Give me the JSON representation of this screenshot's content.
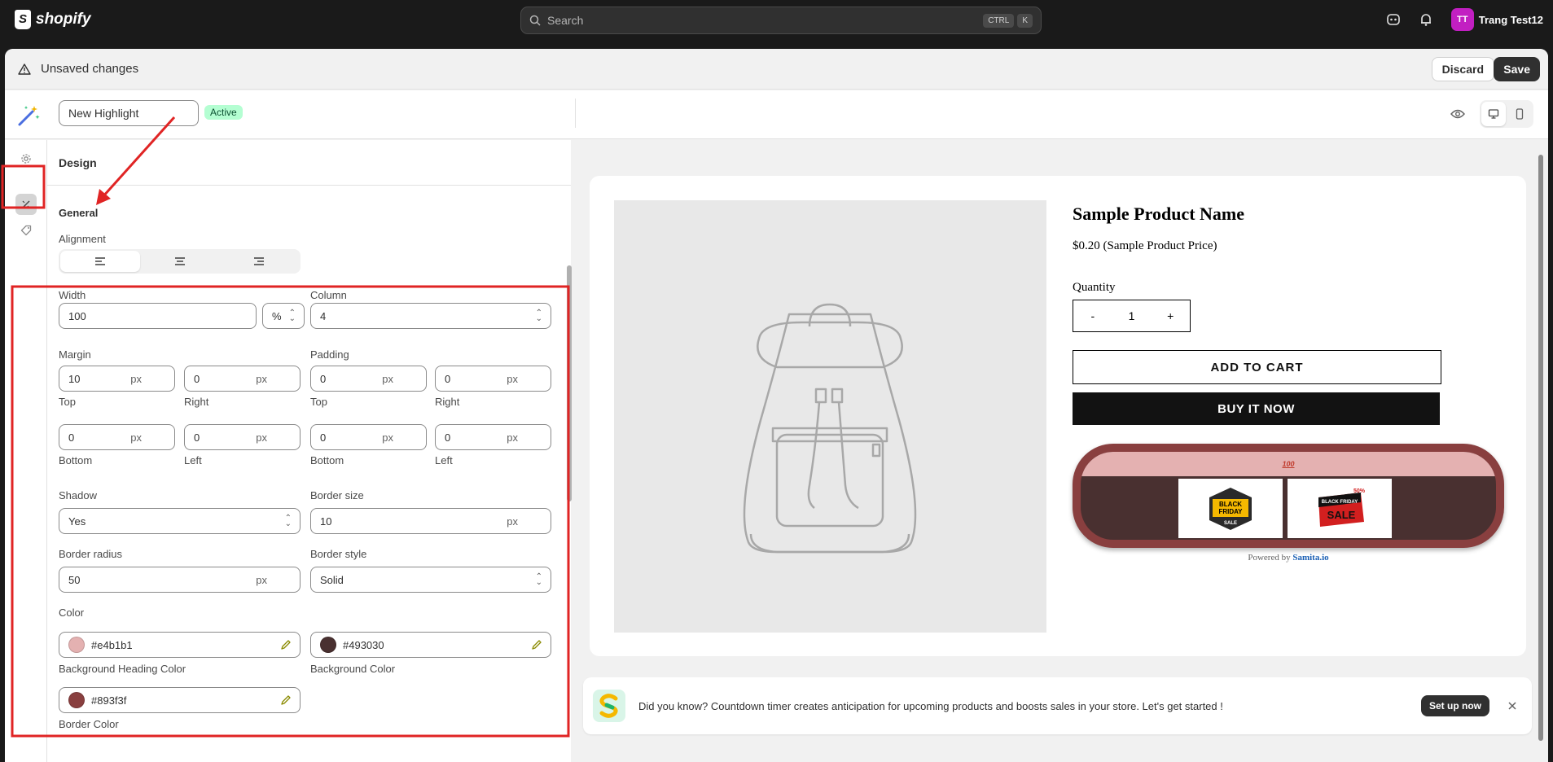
{
  "topbar": {
    "logo_text": "shopify",
    "search_placeholder": "Search",
    "shortcut_key1": "CTRL",
    "shortcut_key2": "K",
    "user_initials": "TT",
    "user_name": "Trang Test12",
    "avatar_color": "#c21fc2"
  },
  "savebar": {
    "message": "Unsaved changes",
    "discard_label": "Discard",
    "save_label": "Save"
  },
  "editor": {
    "highlight_name": "New Highlight",
    "status_badge": "Active"
  },
  "settings": {
    "section_title": "Design",
    "group_title": "General",
    "alignment_label": "Alignment",
    "width_label": "Width",
    "width_value": "100",
    "width_unit": "%",
    "column_label": "Column",
    "column_value": "4",
    "margin_label": "Margin",
    "padding_label": "Padding",
    "margin_top": "10",
    "margin_right": "0",
    "margin_bottom": "0",
    "margin_left": "0",
    "padding_top": "0",
    "padding_right": "0",
    "padding_bottom": "0",
    "padding_left": "0",
    "unit_px": "px",
    "top_label": "Top",
    "right_label": "Right",
    "bottom_label": "Bottom",
    "left_label": "Left",
    "shadow_label": "Shadow",
    "shadow_value": "Yes",
    "border_size_label": "Border size",
    "border_size_value": "10",
    "border_radius_label": "Border radius",
    "border_radius_value": "50",
    "border_style_label": "Border style",
    "border_style_value": "Solid",
    "color_label": "Color",
    "bg_heading_color": "#e4b1b1",
    "bg_heading_color_label": "Background Heading Color",
    "bg_color": "#493030",
    "bg_color_label": "Background Color",
    "border_color": "#893f3f",
    "border_color_label": "Border Color"
  },
  "preview": {
    "product_name": "Sample Product Name",
    "product_price": "$0.20 (Sample Product Price)",
    "quantity_label": "Quantity",
    "qty_minus": "-",
    "qty_value": "1",
    "qty_plus": "+",
    "add_to_cart": "ADD TO CART",
    "buy_now": "BUY IT NOW",
    "highlight_heading": "100",
    "badge1_line1": "BLACK",
    "badge1_line2": "FRIDAY",
    "badge1_line3": "SALE",
    "badge2_line1": "BLACK FRIDAY",
    "badge2_line2": "SALE",
    "badge2_pct": "50%",
    "powered_by": "Powered by",
    "powered_brand": "Samita.io"
  },
  "tip": {
    "text": "Did you know? Countdown timer creates anticipation for upcoming products and boosts sales in your store. Let's get started !",
    "button": "Set up now"
  },
  "annotation_color": "#e02424"
}
